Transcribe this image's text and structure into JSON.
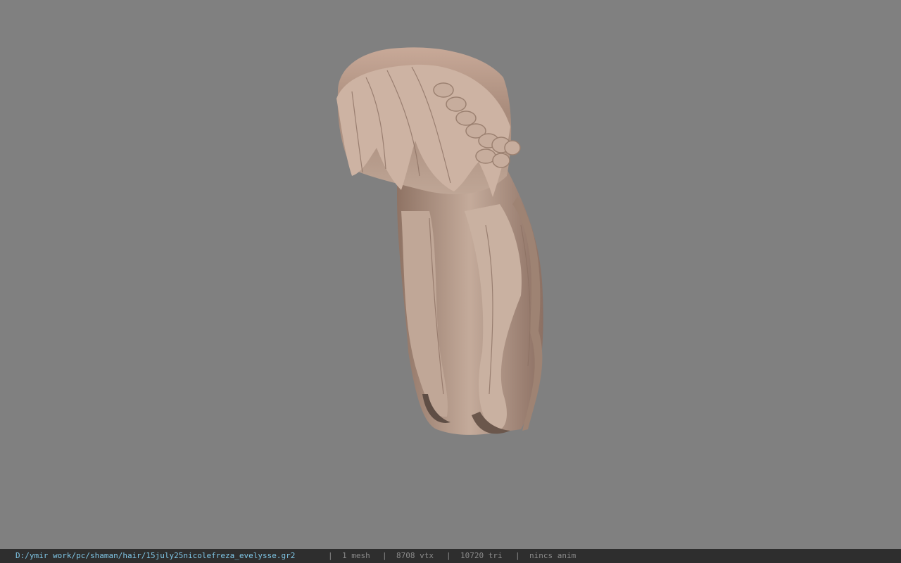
{
  "viewport": {
    "background": "#808080",
    "model_icon": "hair-mesh"
  },
  "statusbar": {
    "file_path": "D:/ymir work/pc/shaman/hair/15july25nicolefreza_evelysse.gr2",
    "separator": "|",
    "mesh_count": "1 mesh",
    "vertex_count": "8708 vtx",
    "triangle_count": "10720 tri",
    "anim": "nincs anim",
    "path_color": "#7fc6e6",
    "text_color": "#8a8a8a",
    "background": "#2e2e2e"
  }
}
